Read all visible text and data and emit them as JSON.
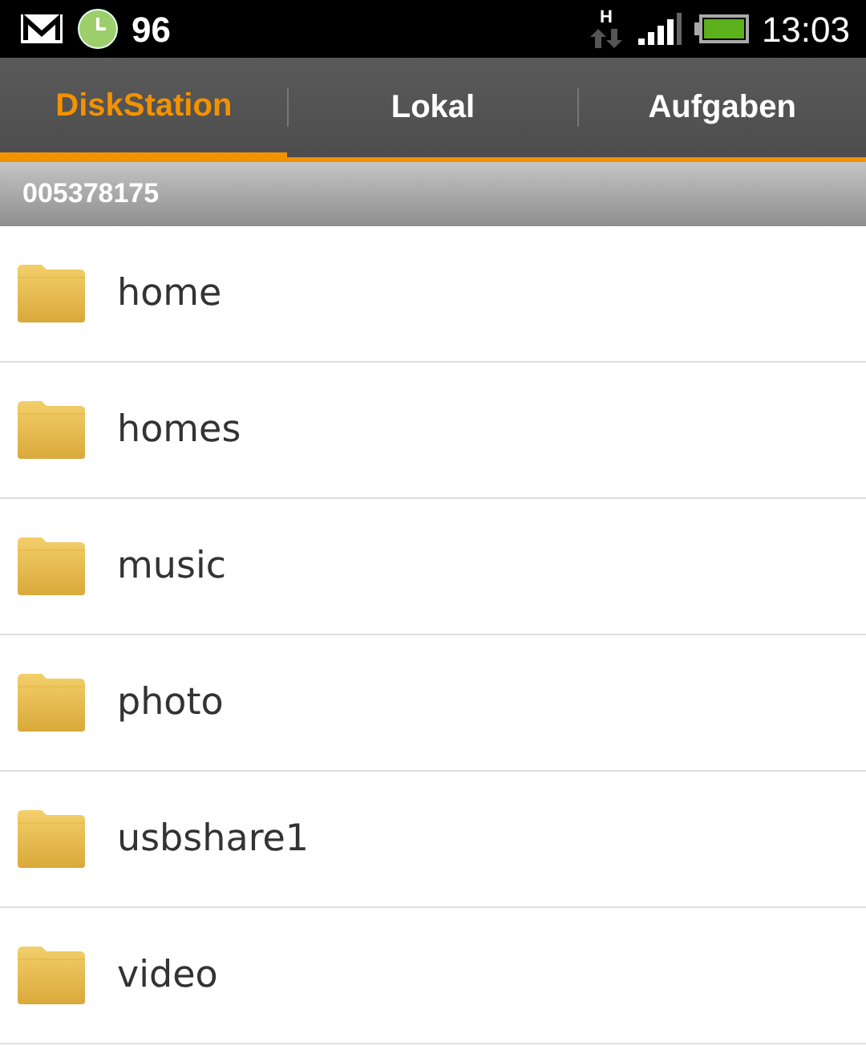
{
  "status_bar": {
    "battery_percent": "96",
    "network_type": "H",
    "time": "13:03"
  },
  "tabs": [
    {
      "label": "DiskStation",
      "selected": true
    },
    {
      "label": "Lokal",
      "selected": false
    },
    {
      "label": "Aufgaben",
      "selected": false
    }
  ],
  "header": "005378175",
  "folders": [
    {
      "name": "home"
    },
    {
      "name": "homes"
    },
    {
      "name": "music"
    },
    {
      "name": "photo"
    },
    {
      "name": "usbshare1"
    },
    {
      "name": "video"
    }
  ]
}
